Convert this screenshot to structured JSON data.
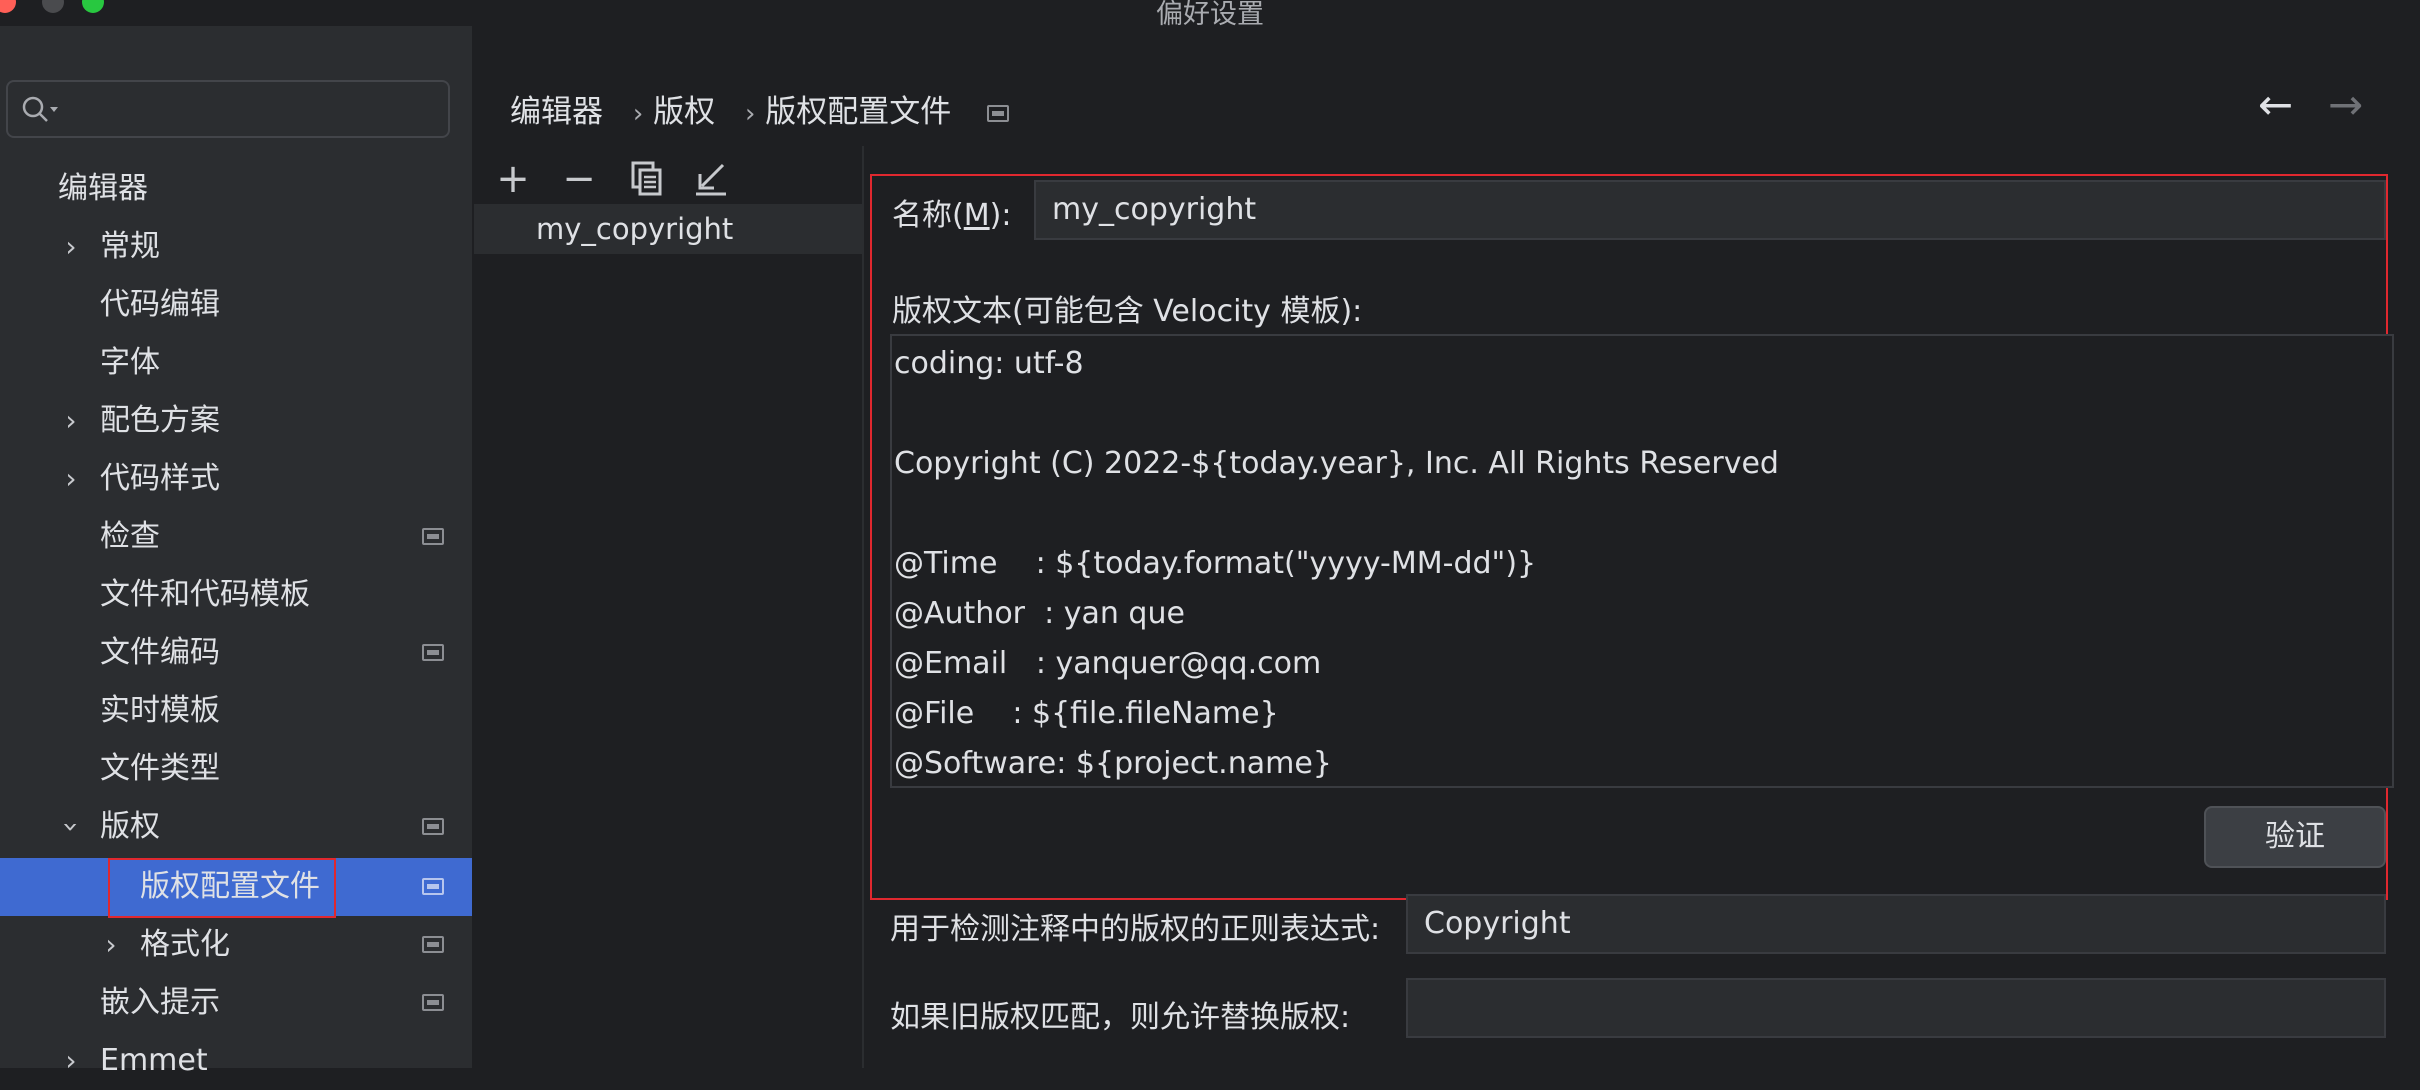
{
  "window": {
    "title": "偏好设置"
  },
  "sidebar": {
    "search_placeholder": "",
    "section_title": "编辑器",
    "items": [
      {
        "label": "常规"
      },
      {
        "label": "代码编辑"
      },
      {
        "label": "字体"
      },
      {
        "label": "配色方案"
      },
      {
        "label": "代码样式"
      },
      {
        "label": "检查"
      },
      {
        "label": "文件和代码模板"
      },
      {
        "label": "文件编码"
      },
      {
        "label": "实时模板"
      },
      {
        "label": "文件类型"
      },
      {
        "label": "版权"
      },
      {
        "label": "版权配置文件"
      },
      {
        "label": "格式化"
      },
      {
        "label": "嵌入提示"
      },
      {
        "label": "Emmet"
      }
    ]
  },
  "breadcrumb": {
    "items": [
      "编辑器",
      "版权",
      "版权配置文件"
    ],
    "separator": "›"
  },
  "nav": {
    "back": "←",
    "forward": "→"
  },
  "toolbar": {
    "add": "+",
    "remove": "−",
    "copy": "copy",
    "import": "import"
  },
  "profiles": [
    "my_copyright"
  ],
  "form": {
    "name_label_prefix": "名称(",
    "name_label_mnemonic": "M",
    "name_label_suffix": "):",
    "name_value": "my_copyright",
    "text_label": "版权文本(可能包含 Velocity 模板):",
    "text_lines": [
      "coding: utf-8",
      "",
      "Copyright (C) 2022-${today.year}, Inc. All Rights Reserved",
      "",
      "@Time    : ${today.format(\"yyyy-MM-dd\")}",
      "@Author  : yan que",
      "@Email   : yanquer@qq.com",
      "@File    : ${file.fileName}",
      "@Software: ${project.name}"
    ],
    "verify_button": "验证",
    "regex_label": "用于检测注释中的版权的正则表达式:",
    "regex_value": "Copyright",
    "replace_label": "如果旧版权匹配，则允许替换版权:",
    "replace_value": ""
  },
  "colors": {
    "selection": "#3f6ad1",
    "highlight_frame": "#e0282f",
    "background": "#1e1f22",
    "panel": "#2b2d30"
  }
}
